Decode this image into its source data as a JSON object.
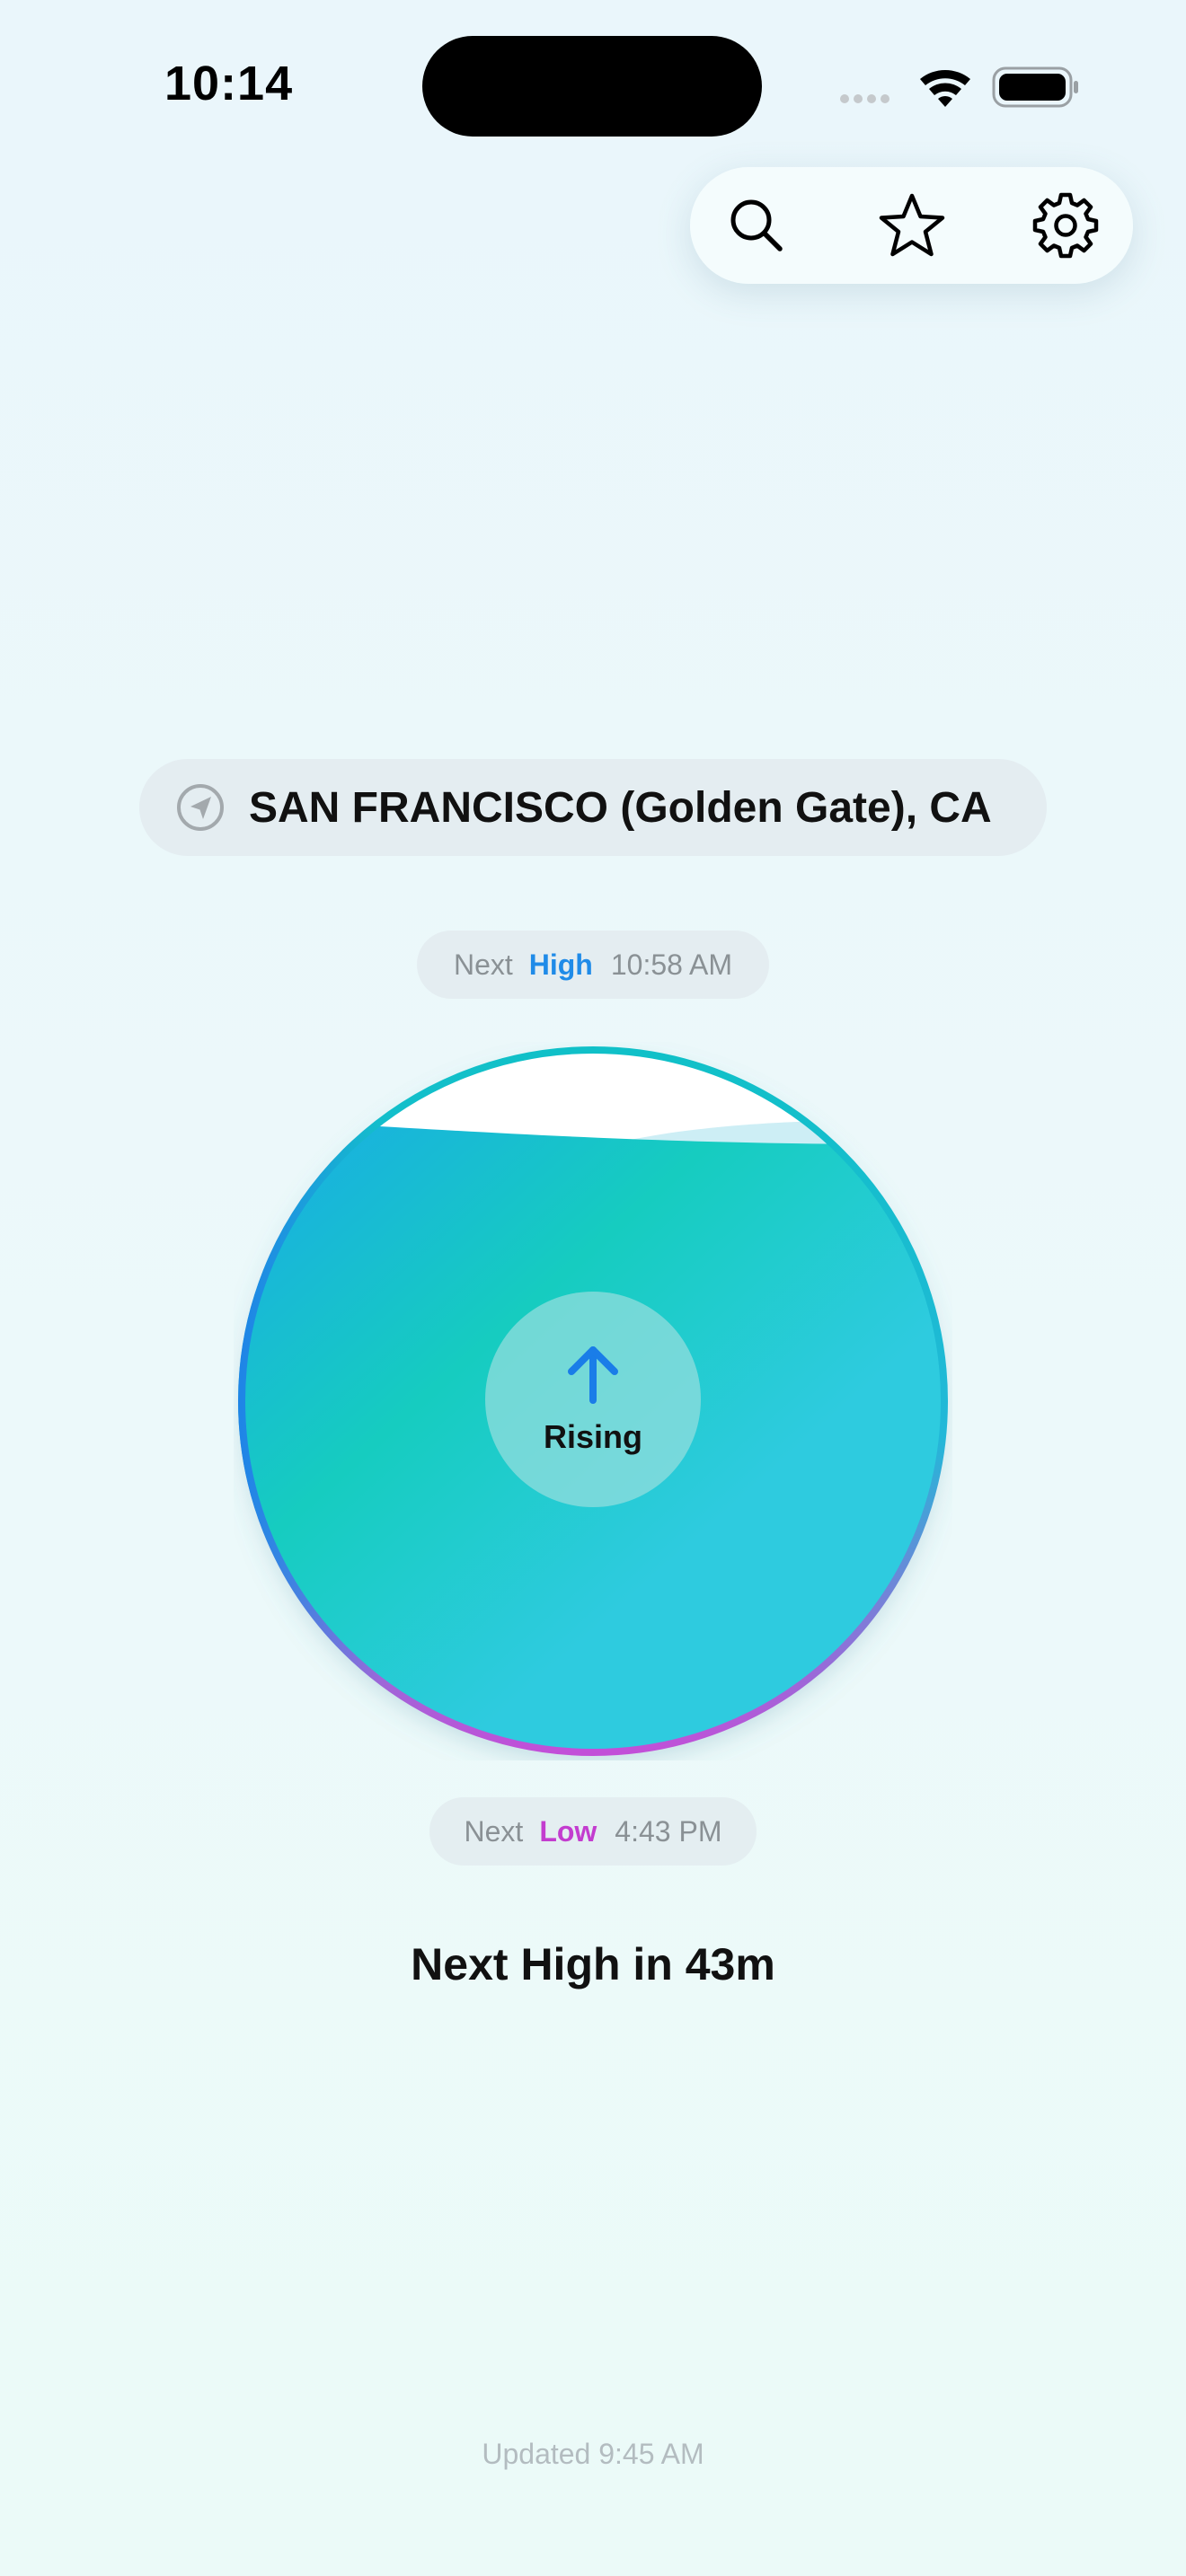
{
  "status_bar": {
    "time": "10:14",
    "icons": [
      "cellular-dots-icon",
      "wifi-icon",
      "battery-icon"
    ]
  },
  "toolbar": {
    "buttons": [
      {
        "icon": "search-icon"
      },
      {
        "icon": "star-icon"
      },
      {
        "icon": "gear-icon"
      }
    ]
  },
  "location": {
    "icon": "location-arrow-icon",
    "label": "SAN FRANCISCO (Golden Gate), CA"
  },
  "next_high": {
    "prefix": "Next",
    "kind": "High",
    "time": "10:58 AM",
    "color": "#1f8be8"
  },
  "next_low": {
    "prefix": "Next",
    "kind": "Low",
    "time": "4:43 PM",
    "color": "#c33ccf"
  },
  "gauge": {
    "trend_label": "Rising",
    "trend_icon": "arrow-up-icon",
    "water_level_fraction": 0.88,
    "colors": {
      "water_start": "#1aabe6",
      "water_mid": "#16ccc0",
      "water_end": "#2ecbdf",
      "ring_top": "#10c0c8",
      "ring_bottom": "#c24fd8"
    }
  },
  "countdown": "Next High in 43m",
  "updated": "Updated 9:45 AM"
}
